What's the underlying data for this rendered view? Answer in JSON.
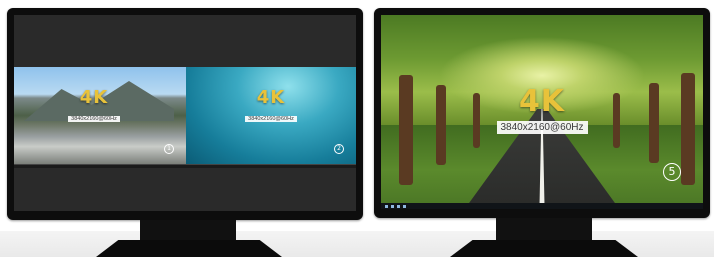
{
  "left_monitor": {
    "panes": [
      {
        "id": "1",
        "badge_title": "4K",
        "badge_resolution": "3840x2160@60Hz"
      },
      {
        "id": "2",
        "badge_title": "4K",
        "badge_resolution": "3840x2160@60Hz"
      }
    ]
  },
  "right_monitor": {
    "badge_title": "4K",
    "badge_resolution": "3840x2160@60Hz",
    "screen_number": "5"
  },
  "colors": {
    "badge_gold": "#e8c23a",
    "bezel": "#0d0d0d",
    "background": "#ffffff"
  },
  "icons": [
    "circled-number-icon"
  ]
}
